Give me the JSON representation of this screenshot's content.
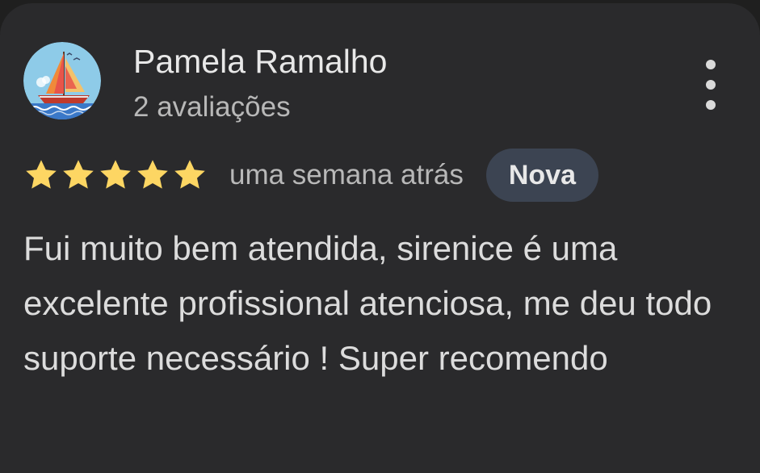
{
  "review": {
    "author": "Pamela Ramalho",
    "review_count": "2 avaliações",
    "rating": 5,
    "rating_max": 5,
    "time_ago": "uma semana atrás",
    "badge": "Nova",
    "text": "Fui muito bem atendida, sirenice é uma excelente profissional atenciosa, me deu todo suporte necessário ! Super recomendo"
  },
  "icons": {
    "avatar": "sailboat-avatar",
    "star": "star-icon",
    "menu": "more-vert-icon"
  },
  "colors": {
    "background": "#2a2a2c",
    "star": "#fdd663",
    "badge_bg": "#3c4452",
    "text_primary": "#e8e8e8",
    "text_secondary": "#b8b8b8"
  }
}
